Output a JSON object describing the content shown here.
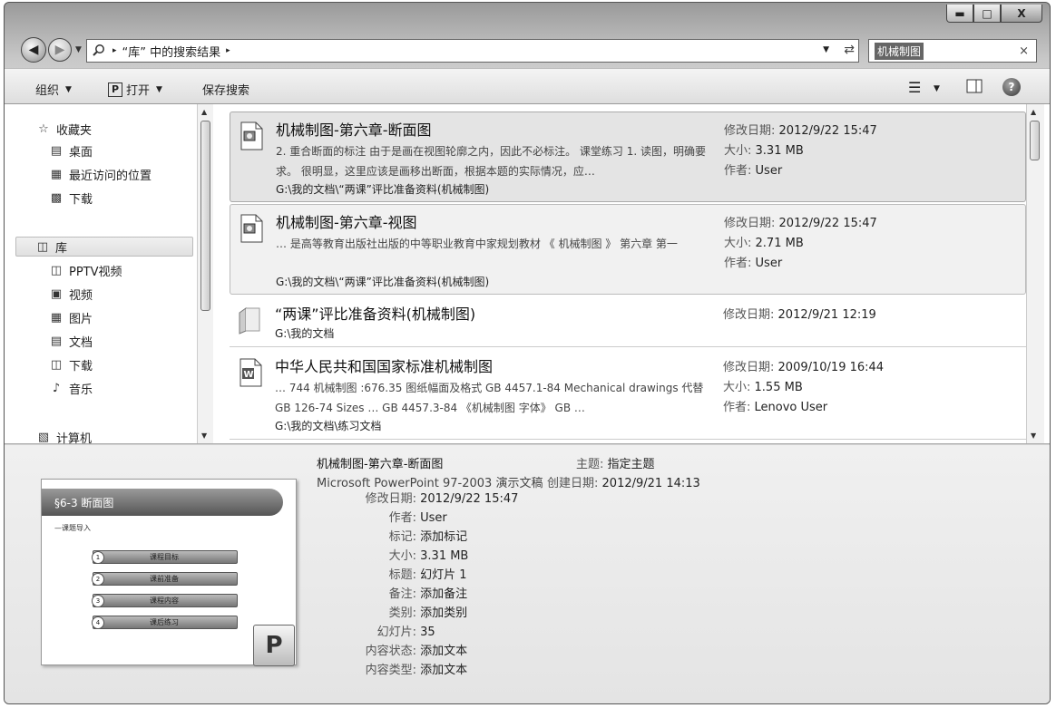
{
  "window": {
    "minimize_glyph": "▬",
    "maximize_glyph": "□",
    "close_glyph": "X"
  },
  "address": {
    "location": "“库” 中的搜索结果",
    "arrow": "▸"
  },
  "search": {
    "term": "机械制图",
    "clear_glyph": "×"
  },
  "toolbar": {
    "organize_label": "组织",
    "open_label": "打开",
    "open_icon_letter": "P",
    "save_search_label": "保存搜索",
    "help_glyph": "?"
  },
  "nav": {
    "favorites_label": "收藏夹",
    "desktop_label": "桌面",
    "recent_label": "最近访问的位置",
    "downloads_label": "下载",
    "libraries_label": "库",
    "pptv_label": "PPTV视频",
    "videos_label": "视频",
    "pictures_label": "图片",
    "documents_label": "文档",
    "lib_downloads_label": "下载",
    "music_label": "音乐",
    "computer_label": "计算机"
  },
  "results": [
    {
      "title": "机械制图-第六章-断面图",
      "snippet": "2. 重合断面的标注 由于是画在视图轮廓之内，因此不必标注。 课堂练习 1. 读图，明确要求。 很明显，这里应该是画移出断面，根据本题的实际情况，应…",
      "path": "G:\\我的文档\\“两课”评比准备资料(机械制图)",
      "modified_key": "修改日期:",
      "modified": "2012/9/22 15:47",
      "size_key": "大小:",
      "size": "3.31 MB",
      "author_key": "作者:",
      "author": "User"
    },
    {
      "title": "机械制图-第六章-视图",
      "snippet": "… 是高等教育出版社出版的中等职业教育中家规划教材 《 机械制图 》 第六章 第一",
      "path": "G:\\我的文档\\“两课”评比准备资料(机械制图)",
      "modified_key": "修改日期:",
      "modified": "2012/9/22 15:47",
      "size_key": "大小:",
      "size": "2.71 MB",
      "author_key": "作者:",
      "author": "User"
    },
    {
      "title": "“两课”评比准备资料(机械制图)",
      "path": "G:\\我的文档",
      "modified_key": "修改日期:",
      "modified": "2012/9/21 12:19"
    },
    {
      "title": "中华人民共和国国家标准机械制图",
      "snippet": "… 744 机械制图 :676.35 图纸幅面及格式 GB 4457.1-84 Mechanical drawings 代替 GB 126-74 Sizes … GB 4457.3-84 《机械制图 字体》 GB …",
      "path": "G:\\我的文档\\练习文档",
      "modified_key": "修改日期:",
      "modified": "2009/10/19 16:44",
      "size_key": "大小:",
      "size": "1.55 MB",
      "author_key": "作者:",
      "author": "Lenovo User"
    }
  ],
  "details": {
    "title": "机械制图-第六章-断面图",
    "type": "Microsoft PowerPoint 97-2003 演示文稿",
    "subject_key": "主题:",
    "subject": "指定主题",
    "created_key": "创建日期:",
    "created": "2012/9/21 14:13",
    "rows": [
      {
        "k": "修改日期:",
        "v": "2012/9/22 15:47"
      },
      {
        "k": "作者:",
        "v": "User"
      },
      {
        "k": "标记:",
        "v": "添加标记"
      },
      {
        "k": "大小:",
        "v": "3.31 MB"
      },
      {
        "k": "标题:",
        "v": "幻灯片 1"
      },
      {
        "k": "备注:",
        "v": "添加备注"
      },
      {
        "k": "类别:",
        "v": "添加类别"
      },
      {
        "k": "幻灯片:",
        "v": "35"
      },
      {
        "k": "内容状态:",
        "v": "添加文本"
      },
      {
        "k": "内容类型:",
        "v": "添加文本"
      }
    ],
    "thumbnail": {
      "heading": "§6-3 断面图",
      "subheading": "—课题导入",
      "buttons": [
        "课程目标",
        "课前准备",
        "课程内容",
        "课后练习"
      ],
      "app_letter": "P"
    }
  },
  "colors": {
    "selected_row": "#e4e4e4",
    "hover_row": "#f1f1f1"
  }
}
